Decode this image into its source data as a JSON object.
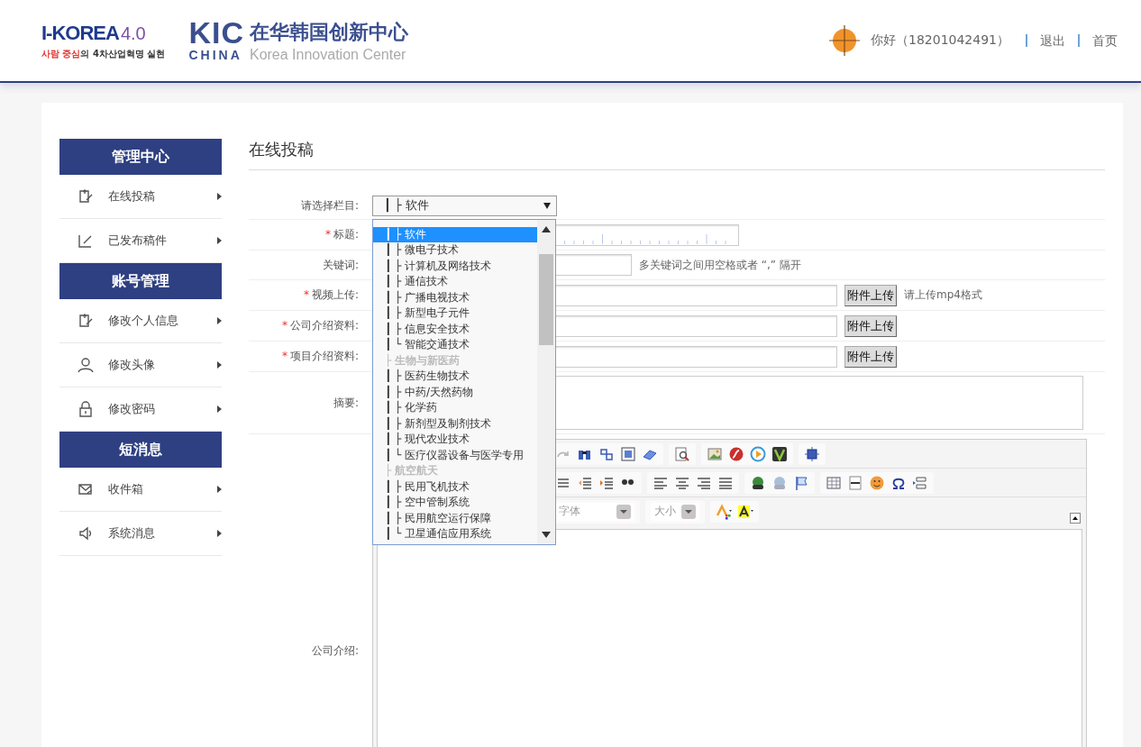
{
  "header": {
    "i_korea": {
      "title": "I-KOREA",
      "version": "4.0",
      "slogan_highlight": "사람 중심",
      "slogan_rest": "의 4차산업혁명 실현"
    },
    "kic": {
      "mark": "KIC",
      "subtitle": "CHINA",
      "name": "在华韩国创新中心",
      "english": "Korea Innovation Center"
    },
    "user": {
      "greeting": "你好（18201042491）",
      "links": [
        "退出",
        "首页"
      ]
    }
  },
  "sidebar": {
    "sections": [
      {
        "title": "管理中心",
        "items": [
          {
            "label": "在线投稿",
            "kind": "post"
          },
          {
            "label": "已发布稿件",
            "kind": "edit"
          }
        ]
      },
      {
        "title": "账号管理",
        "items": [
          {
            "label": "修改个人信息",
            "kind": "post"
          },
          {
            "label": "修改头像",
            "kind": "avatar"
          },
          {
            "label": "修改密码",
            "kind": "lock"
          }
        ]
      },
      {
        "title": "短消息",
        "items": [
          {
            "label": "收件箱",
            "kind": "inbox"
          },
          {
            "label": "系统消息",
            "kind": "speaker"
          }
        ]
      }
    ]
  },
  "main": {
    "title": "在线投稿",
    "fields": [
      {
        "kind": "select",
        "label": "请选择栏目:",
        "value": "┃ ├ 软件"
      },
      {
        "kind": "ruler",
        "label": "标题:",
        "mark": "*"
      },
      {
        "kind": "text",
        "label": "关键词:",
        "hint": "多关键词之间用空格或者 “,” 隔开"
      },
      {
        "kind": "upload",
        "label": "视频上传:",
        "mark": "*",
        "button": "附件上传",
        "hint": "请上传mp4格式"
      },
      {
        "kind": "upload",
        "label": "公司介绍资料:",
        "mark": "*",
        "button": "附件上传"
      },
      {
        "kind": "upload",
        "label": "项目介绍资料:",
        "mark": "*",
        "button": "附件上传"
      },
      {
        "kind": "textarea",
        "label": "摘要:"
      },
      {
        "kind": "editor",
        "label": "公司介绍:",
        "font": "字体",
        "size": "大小"
      }
    ],
    "dropdown": {
      "options": [
        {
          "kind": "item",
          "label": "┃ ├ 软件",
          "selected": true
        },
        {
          "kind": "item",
          "label": "┃ ├ 微电子技术",
          "selected": false
        },
        {
          "kind": "item",
          "label": "┃ ├ 计算机及网络技术",
          "selected": false
        },
        {
          "kind": "item",
          "label": "┃ ├ 通信技术",
          "selected": false
        },
        {
          "kind": "item",
          "label": "┃ ├ 广播电视技术",
          "selected": false
        },
        {
          "kind": "item",
          "label": "┃ ├ 新型电子元件",
          "selected": false
        },
        {
          "kind": "item",
          "label": "┃ ├ 信息安全技术",
          "selected": false
        },
        {
          "kind": "item",
          "label": "┃ └ 智能交通技术",
          "selected": false
        },
        {
          "kind": "group",
          "label": "├ 生物与新医药",
          "selected": false
        },
        {
          "kind": "item",
          "label": "┃ ├ 医药生物技术",
          "selected": false
        },
        {
          "kind": "item",
          "label": "┃ ├ 中药/天然药物",
          "selected": false
        },
        {
          "kind": "item",
          "label": "┃ ├ 化学药",
          "selected": false
        },
        {
          "kind": "item",
          "label": "┃ ├ 新剂型及制剂技术",
          "selected": false
        },
        {
          "kind": "item",
          "label": "┃ ├ 现代农业技术",
          "selected": false
        },
        {
          "kind": "item",
          "label": "┃ └ 医疗仪器设备与医学专用",
          "selected": false
        },
        {
          "kind": "group",
          "label": "├ 航空航天",
          "selected": false
        },
        {
          "kind": "item",
          "label": "┃ ├ 民用飞机技术",
          "selected": false
        },
        {
          "kind": "item",
          "label": "┃ ├ 空中管制系统",
          "selected": false
        },
        {
          "kind": "item",
          "label": "┃ ├ 民用航空运行保障",
          "selected": false
        },
        {
          "kind": "item",
          "label": "┃ └ 卫星通信应用系统",
          "selected": false
        }
      ]
    }
  }
}
